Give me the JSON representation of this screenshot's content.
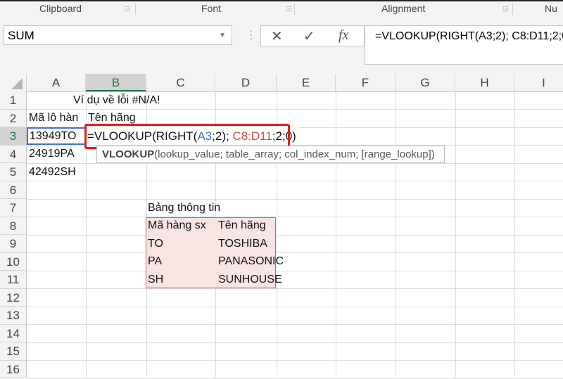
{
  "ribbon": {
    "groups": [
      "Clipboard",
      "Font",
      "Alignment",
      "Nu"
    ]
  },
  "formula_bar": {
    "name_box": "SUM",
    "cancel_icon": "✕",
    "enter_icon": "✓",
    "fx_label": "fx",
    "formula": "=VLOOKUP(RIGHT(A3;2); C8:D11;2;0)"
  },
  "columns": [
    "A",
    "B",
    "C",
    "D",
    "E",
    "F",
    "G",
    "H",
    "I"
  ],
  "rows": [
    "1",
    "2",
    "3",
    "4",
    "5",
    "6",
    "7",
    "8",
    "9",
    "10",
    "11",
    "12",
    "13",
    "14",
    "15",
    "16"
  ],
  "cells": {
    "B1": "Ví dụ về lỗi #N/A!",
    "A2": "Mã lô hàn",
    "B2": "Tên hãng",
    "A3": "13949TO",
    "A4": "24919PA",
    "A5": "42492SH",
    "C7": "Bảng thông tin",
    "C8": "Mã hàng sx",
    "D8": "Tên hãng",
    "C9": "TO",
    "D9": "TOSHIBA",
    "C10": "PA",
    "D10": "PANASONIC",
    "C11": "SH",
    "D11": "SUNHOUSE"
  },
  "edit": {
    "p1": "=VLOOKUP(RIGHT(",
    "p2": "A3",
    "p3": ";2); ",
    "p4": "C8:D11",
    "p5": ";2;0)"
  },
  "tooltip": {
    "fn": "VLOOKUP",
    "args": "(lookup_value; table_array; col_index_num; [range_lookup])"
  },
  "colors": {
    "ref1": "#4472c4",
    "ref2": "#c0504d",
    "highlight": "#e01e1e",
    "accent": "#217346"
  }
}
